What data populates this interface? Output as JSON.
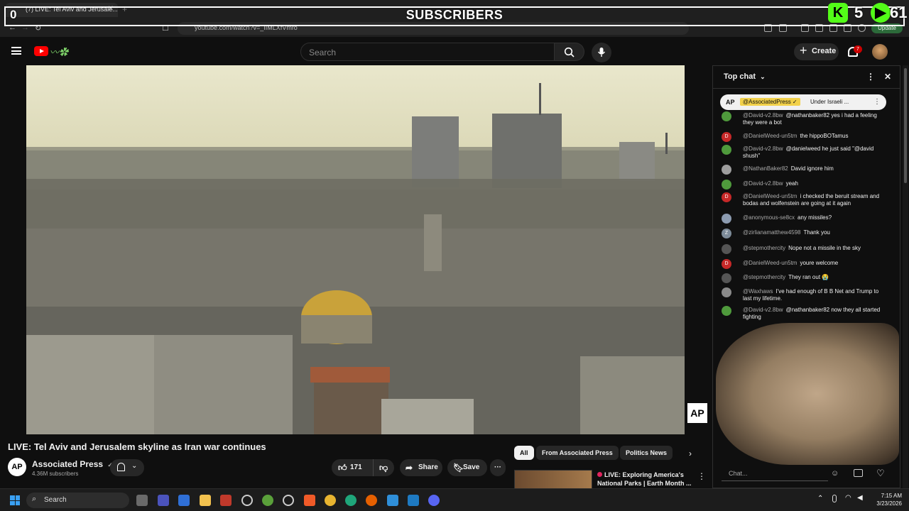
{
  "browser": {
    "tab_title": "(7) LIVE: Tel Aviv and Jerusale...",
    "url": "youtube.com/watch?v=_IIMLXfVmro",
    "update_label": "Update"
  },
  "overlay": {
    "left_count": "0",
    "title": "SUBSCRIBERS",
    "kick_count": "5",
    "rumble_count": "61",
    "kick_icon": "K",
    "rumble_icon": "▶"
  },
  "header": {
    "search_placeholder": "Search",
    "create_label": "Create",
    "notif_count": "7"
  },
  "video": {
    "watermark": "AP",
    "title": "LIVE: Tel Aviv and Jerusalem skyline as Iran war continues"
  },
  "channel": {
    "avatar_text": "AP",
    "name": "Associated Press",
    "verified": "✓",
    "subs": "4.36M subscribers"
  },
  "actions": {
    "likes": "171",
    "share_label": "Share",
    "save_label": "Save",
    "more": "···"
  },
  "chips": [
    "All",
    "From Associated Press",
    "Politics News"
  ],
  "recommendation": {
    "title": "LIVE: Exploring America's National Parks | Earth Month ..."
  },
  "chat": {
    "mode_label": "Top chat",
    "pinned": {
      "ap_label": "AP",
      "handle": "@AssociatedPress ✓",
      "text": "Under Israeli ..."
    },
    "input_placeholder": "Chat...",
    "messages": [
      {
        "user": "@David-v2.8bw",
        "text": "@nathanbaker82 yes i had a feeling they were a bot",
        "av": "",
        "color": "#4f9a3c"
      },
      {
        "user": "@DanielWeed-un5tm",
        "text": "the hippoBOTamus",
        "av": "D",
        "color": "#c62828"
      },
      {
        "user": "@David-v2.8bw",
        "text": "@danielweed he just said \"@david shush\"",
        "av": "",
        "color": "#4f9a3c"
      },
      {
        "user": "@NathanBaker82",
        "text": "David ignore him",
        "av": "",
        "color": "#9e9e9e"
      },
      {
        "user": "@David-v2.8bw",
        "text": "yeah",
        "av": "",
        "color": "#4f9a3c"
      },
      {
        "user": "@DanielWeed-un5tm",
        "text": "i checked the beruit stream and bodas and wolfenstein are going at it again",
        "av": "D",
        "color": "#c62828"
      },
      {
        "user": "@anonymous-se8cx",
        "text": "any missiles?",
        "av": "",
        "color": "#8c9bb0"
      },
      {
        "user": "@zirlianamatthew4598",
        "text": "Thank you",
        "av": "Z",
        "color": "#7d8b99"
      },
      {
        "user": "@stepmothercity",
        "text": "Nope not a missile in the sky",
        "av": "",
        "color": "#555"
      },
      {
        "user": "@DanielWeed-un5tm",
        "text": "youre welcome",
        "av": "D",
        "color": "#c62828"
      },
      {
        "user": "@stepmothercity",
        "text": "They ran out 😭",
        "av": "",
        "color": "#555"
      },
      {
        "user": "@Waxhaws",
        "text": "I've had enough of B B Net and Trump to last my lifetime.",
        "av": "",
        "color": "#8a8a8a"
      },
      {
        "user": "@David-v2.8bw",
        "text": "@nathanbaker82 now they all started fighting",
        "av": "",
        "color": "#4f9a3c"
      }
    ]
  },
  "taskbar": {
    "search_label": "Search",
    "time": "7:15 AM",
    "date": "3/23/2026"
  }
}
